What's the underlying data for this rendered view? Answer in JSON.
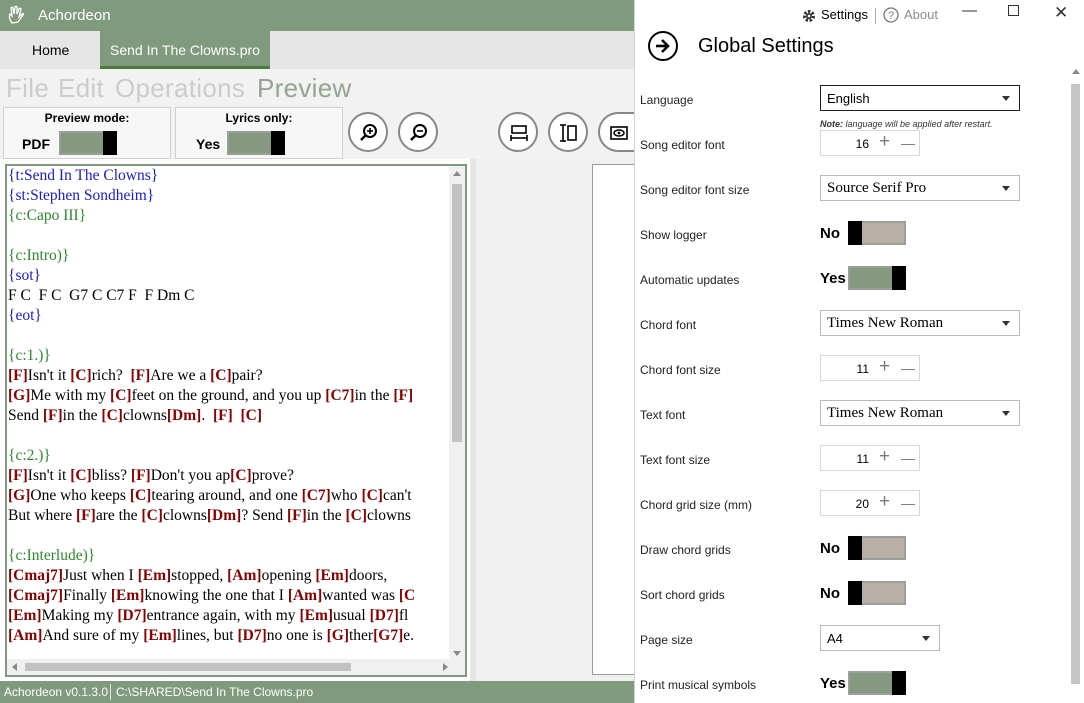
{
  "app": {
    "title": "Achordeon",
    "tabs": [
      {
        "label": "Home",
        "active": false
      },
      {
        "label": "Send In The Clowns.pro",
        "active": true
      }
    ],
    "menu": [
      "File",
      "Edit",
      "Operations",
      "Preview"
    ],
    "active_menu": "Preview",
    "toolbar": {
      "preview_mode_label": "Preview mode:",
      "preview_mode_value": "PDF",
      "lyrics_only_label": "Lyrics only:",
      "lyrics_only_value": "Yes",
      "buttons": [
        "zoom-in-icon",
        "zoom-out-icon",
        "fit-width-icon",
        "fit-height-icon",
        "eye-icon"
      ]
    },
    "editor_lines": [
      [
        {
          "t": "{t:Send In The Clowns}",
          "c": "blue"
        }
      ],
      [
        {
          "t": "{st:Stephen Sondheim}",
          "c": "blue"
        }
      ],
      [
        {
          "t": "{c:Capo III}",
          "c": "green"
        }
      ],
      [],
      [
        {
          "t": "{c:Intro)}",
          "c": "green"
        }
      ],
      [
        {
          "t": "{sot}",
          "c": "blue"
        }
      ],
      [
        {
          "t": "F C  F C  G7 C C7 F  F Dm C",
          "c": "plain"
        }
      ],
      [
        {
          "t": "{eot}",
          "c": "blue"
        }
      ],
      [],
      [
        {
          "t": "{c:1.)}",
          "c": "green"
        }
      ],
      [
        {
          "t": "[F]",
          "c": "chord"
        },
        {
          "t": "Isn't it ",
          "c": "plain"
        },
        {
          "t": "[C]",
          "c": "chord"
        },
        {
          "t": "rich?  ",
          "c": "plain"
        },
        {
          "t": "[F]",
          "c": "chord"
        },
        {
          "t": "Are we a ",
          "c": "plain"
        },
        {
          "t": "[C]",
          "c": "chord"
        },
        {
          "t": "pair?",
          "c": "plain"
        }
      ],
      [
        {
          "t": "[G]",
          "c": "chord"
        },
        {
          "t": "Me with my ",
          "c": "plain"
        },
        {
          "t": "[C]",
          "c": "chord"
        },
        {
          "t": "feet on the ground, and you up ",
          "c": "plain"
        },
        {
          "t": "[C7]",
          "c": "chord"
        },
        {
          "t": "in the ",
          "c": "plain"
        },
        {
          "t": "[F]",
          "c": "chord"
        }
      ],
      [
        {
          "t": "Send ",
          "c": "plain"
        },
        {
          "t": "[F]",
          "c": "chord"
        },
        {
          "t": "in the ",
          "c": "plain"
        },
        {
          "t": "[C]",
          "c": "chord"
        },
        {
          "t": "clowns",
          "c": "plain"
        },
        {
          "t": "[Dm]",
          "c": "chord"
        },
        {
          "t": ".  ",
          "c": "plain"
        },
        {
          "t": "[F]",
          "c": "chord"
        },
        {
          "t": "  ",
          "c": "plain"
        },
        {
          "t": "[C]",
          "c": "chord"
        }
      ],
      [],
      [
        {
          "t": "{c:2.)}",
          "c": "green"
        }
      ],
      [
        {
          "t": "[F]",
          "c": "chord"
        },
        {
          "t": "Isn't it ",
          "c": "plain"
        },
        {
          "t": "[C]",
          "c": "chord"
        },
        {
          "t": "bliss? ",
          "c": "plain"
        },
        {
          "t": "[F]",
          "c": "chord"
        },
        {
          "t": "Don't you ap",
          "c": "plain"
        },
        {
          "t": "[C]",
          "c": "chord"
        },
        {
          "t": "prove?",
          "c": "plain"
        }
      ],
      [
        {
          "t": "[G]",
          "c": "chord"
        },
        {
          "t": "One who keeps ",
          "c": "plain"
        },
        {
          "t": "[C]",
          "c": "chord"
        },
        {
          "t": "tearing around, and one ",
          "c": "plain"
        },
        {
          "t": "[C7]",
          "c": "chord"
        },
        {
          "t": "who ",
          "c": "plain"
        },
        {
          "t": "[C]",
          "c": "chord"
        },
        {
          "t": "can't",
          "c": "plain"
        }
      ],
      [
        {
          "t": "But where ",
          "c": "plain"
        },
        {
          "t": "[F]",
          "c": "chord"
        },
        {
          "t": "are the ",
          "c": "plain"
        },
        {
          "t": "[C]",
          "c": "chord"
        },
        {
          "t": "clowns",
          "c": "plain"
        },
        {
          "t": "[Dm]",
          "c": "chord"
        },
        {
          "t": "? Send ",
          "c": "plain"
        },
        {
          "t": "[F]",
          "c": "chord"
        },
        {
          "t": "in the ",
          "c": "plain"
        },
        {
          "t": "[C]",
          "c": "chord"
        },
        {
          "t": "clowns",
          "c": "plain"
        }
      ],
      [],
      [
        {
          "t": "{c:Interlude)}",
          "c": "green"
        }
      ],
      [
        {
          "t": "[Cmaj7]",
          "c": "chord"
        },
        {
          "t": "Just when I ",
          "c": "plain"
        },
        {
          "t": "[Em]",
          "c": "chord"
        },
        {
          "t": "stopped, ",
          "c": "plain"
        },
        {
          "t": "[Am]",
          "c": "chord"
        },
        {
          "t": "opening ",
          "c": "plain"
        },
        {
          "t": "[Em]",
          "c": "chord"
        },
        {
          "t": "doors,",
          "c": "plain"
        }
      ],
      [
        {
          "t": "[Cmaj7]",
          "c": "chord"
        },
        {
          "t": "Finally ",
          "c": "plain"
        },
        {
          "t": "[Em]",
          "c": "chord"
        },
        {
          "t": "knowing the one that I ",
          "c": "plain"
        },
        {
          "t": "[Am]",
          "c": "chord"
        },
        {
          "t": "wanted was ",
          "c": "plain"
        },
        {
          "t": "[C",
          "c": "chord"
        }
      ],
      [
        {
          "t": "[Em]",
          "c": "chord"
        },
        {
          "t": "Making my ",
          "c": "plain"
        },
        {
          "t": "[D7]",
          "c": "chord"
        },
        {
          "t": "entrance again, with my ",
          "c": "plain"
        },
        {
          "t": "[Em]",
          "c": "chord"
        },
        {
          "t": "usual ",
          "c": "plain"
        },
        {
          "t": "[D7]",
          "c": "chord"
        },
        {
          "t": "fl",
          "c": "plain"
        }
      ],
      [
        {
          "t": "[Am]",
          "c": "chord"
        },
        {
          "t": "And sure of my ",
          "c": "plain"
        },
        {
          "t": "[Em]",
          "c": "chord"
        },
        {
          "t": "lines, but ",
          "c": "plain"
        },
        {
          "t": "[D7]",
          "c": "chord"
        },
        {
          "t": "no one is ",
          "c": "plain"
        },
        {
          "t": "[G]",
          "c": "chord"
        },
        {
          "t": "ther",
          "c": "plain"
        },
        {
          "t": "[G7]",
          "c": "chord"
        },
        {
          "t": "e.",
          "c": "plain"
        }
      ]
    ],
    "status": {
      "version": "Achordeon v0.1.3.0",
      "path": "C:\\SHARED\\Send In The Clowns.pro"
    },
    "colors": {
      "accent": "#7f9a7c",
      "chord": "#8b0000",
      "directive_blue": "#1a1ad8",
      "directive_green": "#2a8a2a"
    }
  },
  "settings": {
    "top": {
      "settings_label": "Settings",
      "about_label": "About"
    },
    "title": "Global Settings",
    "rows": [
      {
        "label": "Language",
        "type": "combo",
        "value": "English",
        "note_bold": "Note:",
        "note": " language will be applied after restart."
      },
      {
        "label": "Song editor font",
        "type": "stepper",
        "value": "16"
      },
      {
        "label": "Song editor font size",
        "type": "combo",
        "value": "Source Serif Pro"
      },
      {
        "label": "Show logger",
        "type": "toggle",
        "value": "No"
      },
      {
        "label": "Automatic updates",
        "type": "toggle",
        "value": "Yes"
      },
      {
        "label": "Chord font",
        "type": "combo",
        "value": "Times New Roman"
      },
      {
        "label": "Chord font size",
        "type": "stepper",
        "value": "11"
      },
      {
        "label": "Text font",
        "type": "combo",
        "value": "Times New Roman"
      },
      {
        "label": "Text font size",
        "type": "stepper",
        "value": "11"
      },
      {
        "label": "Chord grid size (mm)",
        "type": "stepper",
        "value": "20"
      },
      {
        "label": "Draw chord grids",
        "type": "toggle",
        "value": "No"
      },
      {
        "label": "Sort chord grids",
        "type": "toggle",
        "value": "No"
      },
      {
        "label": "Page size",
        "type": "combo",
        "value": "A4"
      },
      {
        "label": "Print musical symbols",
        "type": "toggle",
        "value": "Yes"
      }
    ]
  }
}
